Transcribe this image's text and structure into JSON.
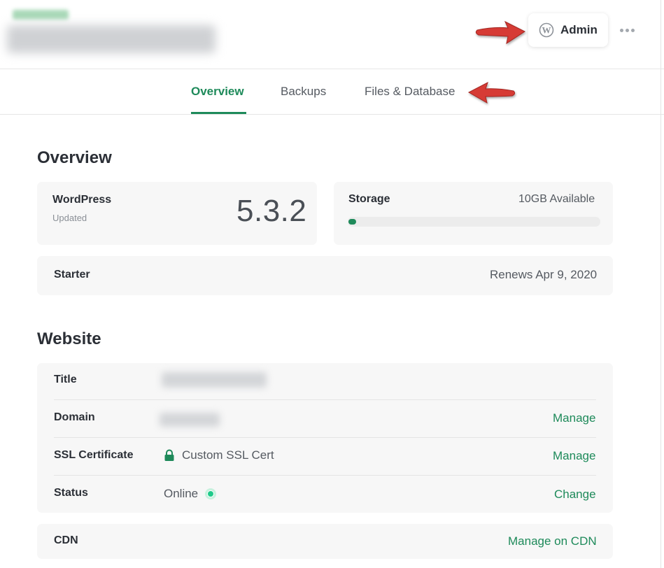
{
  "header": {
    "admin_label": "Admin",
    "icons": {
      "admin": "wordpress-icon",
      "more": "more-horizontal-icon"
    }
  },
  "tabs": [
    {
      "label": "Overview",
      "active": true
    },
    {
      "label": "Backups",
      "active": false
    },
    {
      "label": "Files & Database",
      "active": false
    }
  ],
  "overview": {
    "title": "Overview",
    "wordpress": {
      "label": "WordPress",
      "sub": "Updated",
      "version": "5.3.2"
    },
    "storage": {
      "label": "Storage",
      "available": "10GB Available",
      "used_fraction": 0.03
    },
    "plan": {
      "label": "Starter",
      "renews": "Renews Apr 9, 2020"
    }
  },
  "website": {
    "title": "Website",
    "rows": [
      {
        "label": "Title"
      },
      {
        "label": "Domain",
        "action": "Manage"
      },
      {
        "label": "SSL Certificate",
        "value": "Custom SSL Cert",
        "action": "Manage",
        "icon": "lock-icon"
      },
      {
        "label": "Status",
        "value": "Online",
        "action": "Change"
      }
    ],
    "cdn": {
      "label": "CDN",
      "action": "Manage on CDN"
    }
  },
  "colors": {
    "accent": "#1e8a5a",
    "status_online": "#1fca8a",
    "annotation_arrow": "#d63b35"
  }
}
